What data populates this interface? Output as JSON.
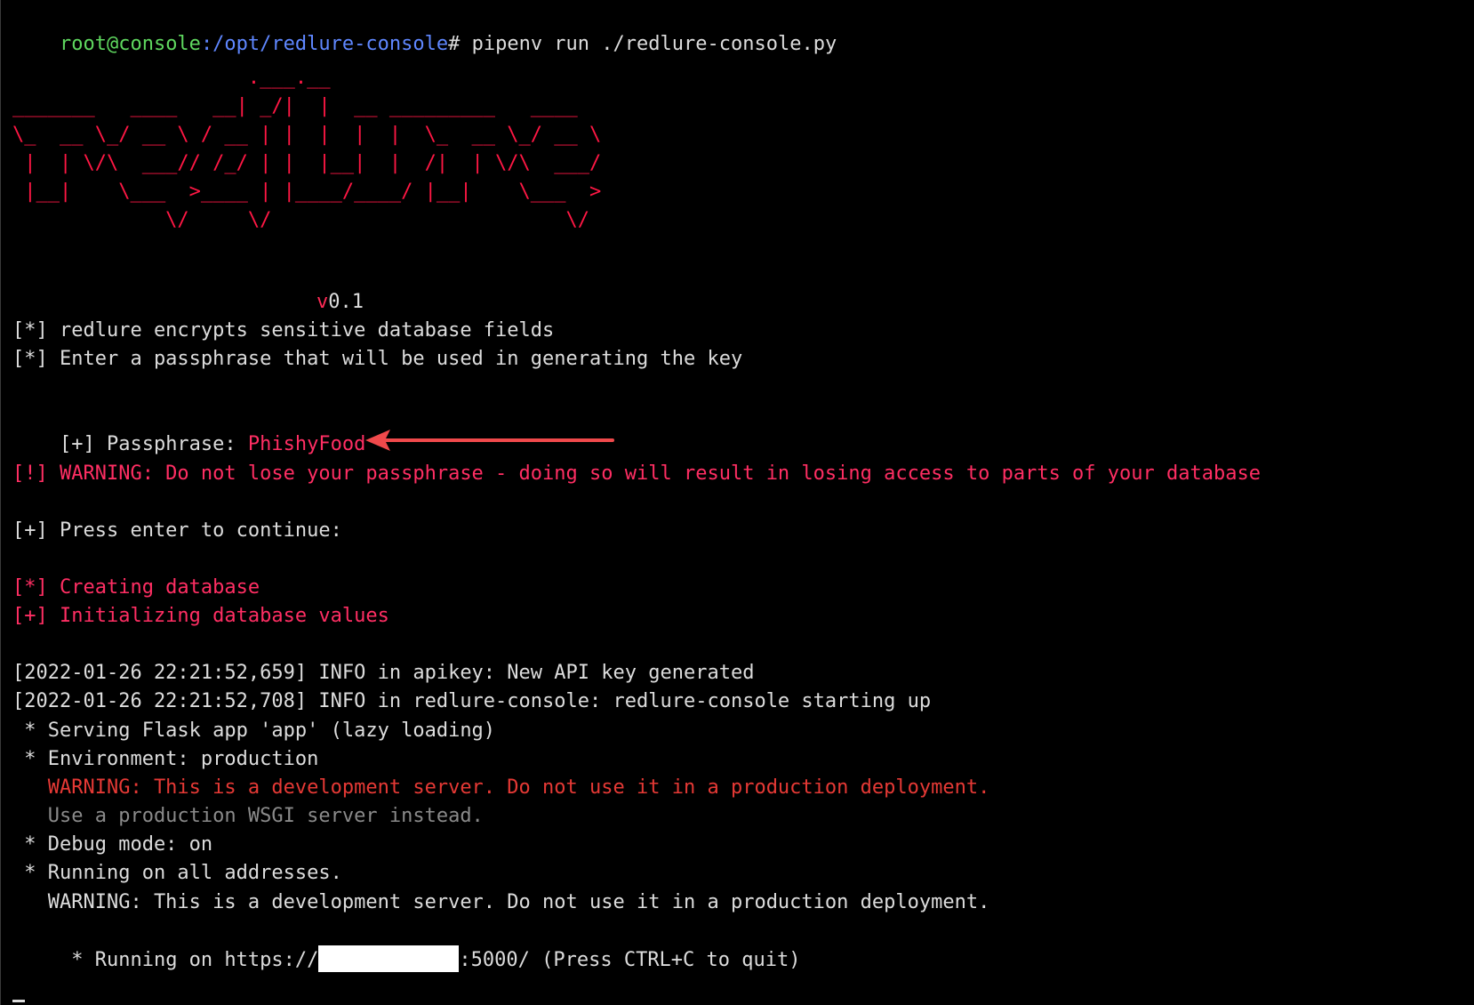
{
  "prompt": {
    "user": "root@console",
    "path": ":/opt/redlure-console",
    "symbol": "# ",
    "command": "pipenv run ./redlure-console.py"
  },
  "banner": {
    "rows": [
      "                    .___.__",
      "_______   ____   __| _/|  |  __ _________   ____",
      "\\_  __ \\_/ __ \\ / __ | |  |  |  |  \\_  __ \\_/ __ \\",
      " |  | \\/\\  ___// /_/ | |  |__|  |  /|  | \\/\\  ___/",
      " |__|    \\___  >____ | |____/____/ |__|    \\___  >",
      "             \\/     \\/                         \\/"
    ],
    "version_prefix": "v",
    "version_number": "0.1"
  },
  "lines": {
    "info1": "[*] redlure encrypts sensitive database fields",
    "info2": "[*] Enter a passphrase that will be used in generating the key",
    "passphrase_label": "[+] Passphrase: ",
    "passphrase_value": "PhishyFood",
    "warning": "[!] WARNING: Do not lose your passphrase - doing so will result in losing access to parts of your database",
    "press_enter": "[+] Press enter to continue:",
    "creating_db": "[*] Creating database",
    "init_db": "[+] Initializing database values",
    "log1": "[2022-01-26 22:21:52,659] INFO in apikey: New API key generated",
    "log2": "[2022-01-26 22:21:52,708] INFO in redlure-console: redlure-console starting up",
    "flask1": " * Serving Flask app 'app' (lazy loading)",
    "flask2": " * Environment: production",
    "flask_warn": "   WARNING: This is a development server. Do not use it in a production deployment.",
    "flask_wsgi": "   Use a production WSGI server instead.",
    "flask3": " * Debug mode: on",
    "flask4": " * Running on all addresses.",
    "flask_warn2": "   WARNING: This is a development server. Do not use it in a production deployment.",
    "running_prefix": " * Running on https://",
    "running_suffix": ":5000/ (Press CTRL+C to quit)"
  },
  "colors": {
    "background": "#000000",
    "text": "#dcdcdc",
    "prompt_user": "#5fd75f",
    "prompt_path": "#5f87ff",
    "accent_red": "#ff2a55",
    "arrow": "#f0494b"
  },
  "icons": {
    "annotation": "left-arrow-icon"
  }
}
